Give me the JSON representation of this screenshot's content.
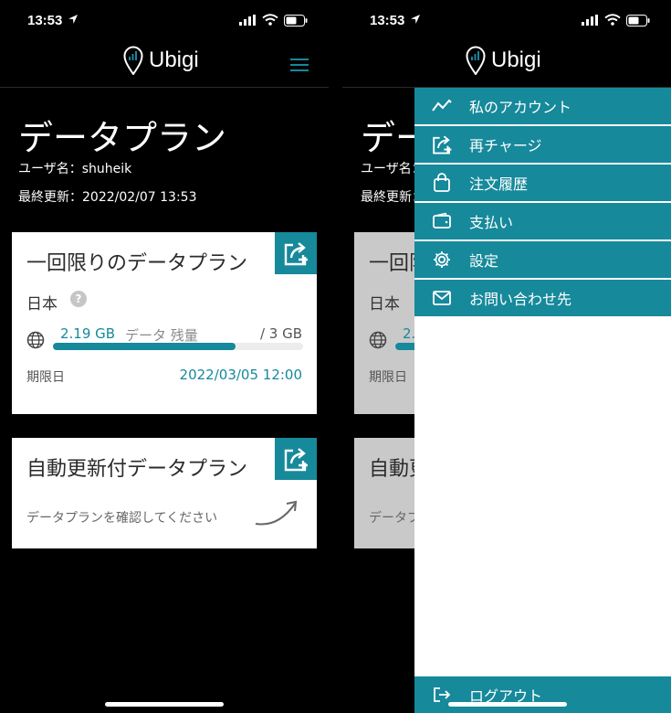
{
  "status": {
    "time": "13:53"
  },
  "brand": {
    "name": "Ubigi"
  },
  "page": {
    "title": "データプラン",
    "username_line": "ユーザ名：shuheik",
    "updated_line": "最終更新：2022/02/07 13:53"
  },
  "card_onetime": {
    "title": "一回限りのデータプラン",
    "country": "日本",
    "help_glyph": "?",
    "data_used": "2.19 GB",
    "data_label": "データ 残量",
    "data_total": "/ 3 GB",
    "remaining_fraction": 0.73,
    "expiry_label": "期限日",
    "expiry_date": "2022/03/05 12:00"
  },
  "card_auto": {
    "title": "自動更新付データプラン",
    "confirm_text": "データプランを確認してください"
  },
  "menu": {
    "items": [
      {
        "label": "私のアカウント",
        "icon": "activity-chart-icon"
      },
      {
        "label": "再チャージ",
        "icon": "recharge-icon"
      },
      {
        "label": "注文履歴",
        "icon": "shopping-bag-icon"
      },
      {
        "label": "支払い",
        "icon": "wallet-icon"
      },
      {
        "label": "設定",
        "icon": "gear-icon"
      },
      {
        "label": "お問い合わせ先",
        "icon": "mail-icon"
      }
    ],
    "logout_label": "ログアウト"
  },
  "colors": {
    "accent": "#16899b",
    "background": "#000000",
    "card": "#ffffff"
  }
}
